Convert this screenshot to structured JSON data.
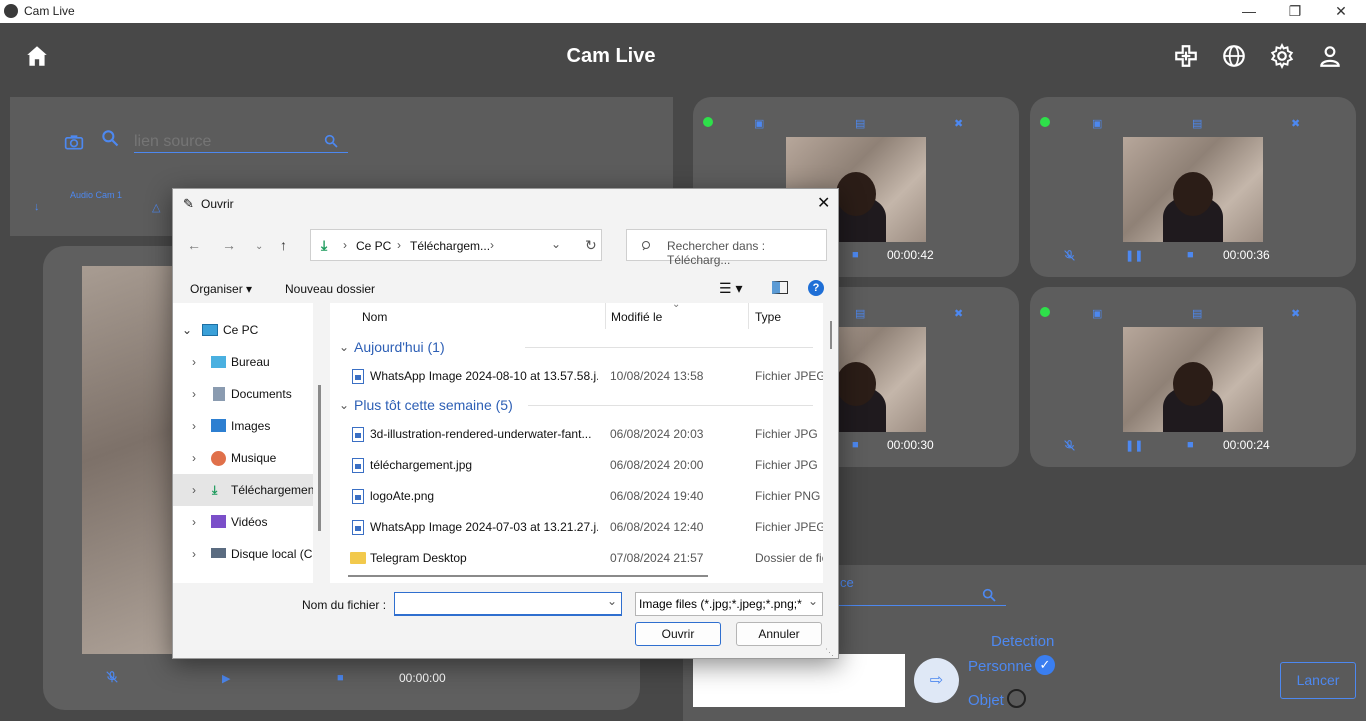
{
  "window": {
    "title": "Cam Live"
  },
  "header": {
    "title": "Cam Live"
  },
  "source_panel": {
    "placeholder": "lien source",
    "audio_label": "Audio Cam 1"
  },
  "main_player": {
    "time": "00:00:00"
  },
  "tiles": [
    {
      "time": "00:00:42"
    },
    {
      "time": "00:00:36"
    },
    {
      "time": "00:00:30"
    },
    {
      "time": "00:00:24"
    }
  ],
  "bottom_panel": {
    "source_fragment": "ce",
    "detection_label": "Detection",
    "person_label": "Personne",
    "object_label": "Objet",
    "launch_label": "Lancer"
  },
  "dialog": {
    "title": "Ouvrir",
    "breadcrumb": [
      "Ce PC",
      "Téléchargem..."
    ],
    "search_placeholder": "Rechercher dans : Télécharg...",
    "organize_label": "Organiser",
    "new_folder_label": "Nouveau dossier",
    "columns": {
      "name": "Nom",
      "modified": "Modifié le",
      "type": "Type"
    },
    "nav_items": [
      {
        "label": "Ce PC",
        "icon": "pc-icon"
      },
      {
        "label": "Bureau",
        "icon": "desktop-icon"
      },
      {
        "label": "Documents",
        "icon": "documents-icon"
      },
      {
        "label": "Images",
        "icon": "images-icon"
      },
      {
        "label": "Musique",
        "icon": "music-icon"
      },
      {
        "label": "Téléchargements",
        "icon": "download-icon"
      },
      {
        "label": "Vidéos",
        "icon": "videos-icon"
      },
      {
        "label": "Disque local (C:)",
        "icon": "drive-icon"
      }
    ],
    "groups": [
      {
        "label": "Aujourd'hui (1)",
        "files": [
          {
            "name": "WhatsApp Image 2024-08-10 at 13.57.58.j...",
            "date": "10/08/2024 13:58",
            "type": "Fichier JPEG"
          }
        ]
      },
      {
        "label": "Plus tôt cette semaine (5)",
        "files": [
          {
            "name": "3d-illustration-rendered-underwater-fant...",
            "date": "06/08/2024 20:03",
            "type": "Fichier JPG"
          },
          {
            "name": "téléchargement.jpg",
            "date": "06/08/2024 20:00",
            "type": "Fichier JPG"
          },
          {
            "name": "logoAte.png",
            "date": "06/08/2024 19:40",
            "type": "Fichier PNG"
          },
          {
            "name": "WhatsApp Image 2024-07-03 at 13.21.27.j...",
            "date": "06/08/2024 12:40",
            "type": "Fichier JPEG"
          },
          {
            "name": "Telegram Desktop",
            "date": "07/08/2024 21:57",
            "type": "Dossier de fic"
          }
        ]
      }
    ],
    "filename_label": "Nom du fichier :",
    "filename_value": "",
    "filter_value": "Image files (*.jpg;*.jpeg;*.png;*",
    "open_label": "Ouvrir",
    "cancel_label": "Annuler"
  }
}
